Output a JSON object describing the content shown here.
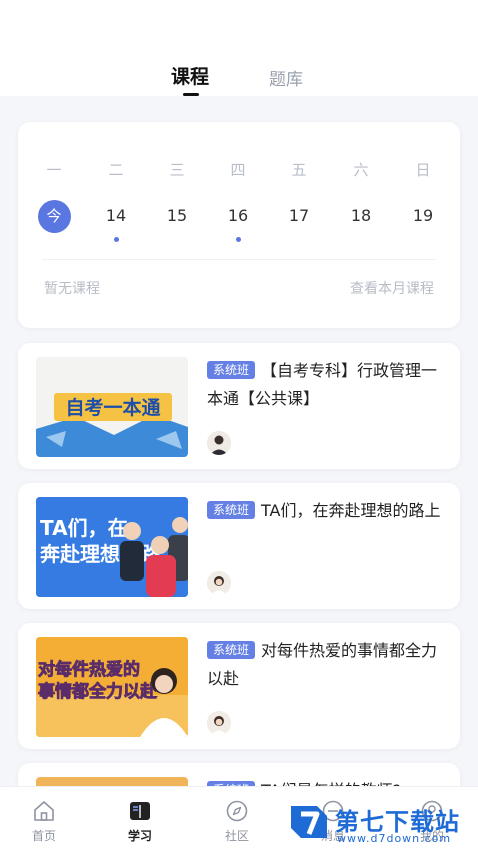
{
  "tabs": {
    "active": "课程",
    "inactive": "题库"
  },
  "calendar": {
    "weekdays": [
      "一",
      "二",
      "三",
      "四",
      "五",
      "六",
      "日"
    ],
    "dates": [
      "今",
      "14",
      "15",
      "16",
      "17",
      "18",
      "19"
    ],
    "marked_dates": [
      "14",
      "16"
    ],
    "empty_text": "暂无课程",
    "month_link": "查看本月课程"
  },
  "courses": [
    {
      "badge": "系统班",
      "title": "【自考专科】行政管理一本通【公共课】",
      "thumb_text": "自考一本通"
    },
    {
      "badge": "系统班",
      "title": "TA们，在奔赴理想的路上",
      "thumb_text": "TA们，在\n奔赴理想的路上"
    },
    {
      "badge": "系统班",
      "title": "对每件热爱的事情都全力以赴",
      "thumb_text": "对每件热爱的\n事情都全力以赴"
    },
    {
      "badge": "系统班",
      "title": "TA们是怎样的教师?",
      "thumb_text": ""
    }
  ],
  "nav": [
    {
      "label": "首页",
      "icon": "home-icon"
    },
    {
      "label": "学习",
      "icon": "book-icon"
    },
    {
      "label": "社区",
      "icon": "compass-icon"
    },
    {
      "label": "消息",
      "icon": "message-icon"
    },
    {
      "label": "我的",
      "icon": "profile-icon"
    }
  ],
  "watermark": {
    "text": "第七下载站",
    "sub": "www.d7down.com"
  },
  "colors": {
    "accent": "#5a76e0",
    "badge": "#6580e4",
    "background": "#f4f6fa"
  }
}
